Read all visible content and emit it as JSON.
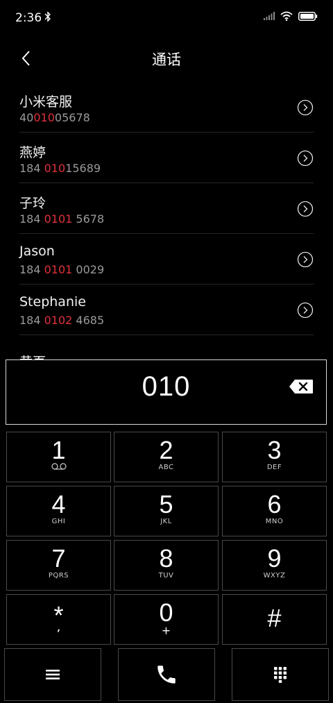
{
  "status_bar": {
    "time": "2:36",
    "icons": [
      "bluetooth-icon",
      "signal-icon",
      "wifi-icon",
      "battery-icon"
    ]
  },
  "header": {
    "title": "通话",
    "back_icon": "chevron-left-icon"
  },
  "contacts": [
    {
      "name": "小米客服",
      "number_pre": "40",
      "number_match": "010",
      "number_post": "05678"
    },
    {
      "name": "燕婷",
      "number_pre": "184 ",
      "number_match": "010",
      "number_post": "15689"
    },
    {
      "name": "子玲",
      "number_pre": "184 ",
      "number_match": "0101",
      "number_post": " 5678"
    },
    {
      "name": "Jason",
      "number_pre": "184 ",
      "number_match": "0101",
      "number_post": " 0029"
    },
    {
      "name": "Stephanie",
      "number_pre": "184 ",
      "number_match": "0102",
      "number_post": " 4685"
    },
    {
      "name": "黄页"
    }
  ],
  "dial": {
    "number": "010",
    "backspace_icon": "backspace-icon"
  },
  "keypad": {
    "keys": [
      {
        "digit": "1",
        "letters": ""
      },
      {
        "digit": "2",
        "letters": "ABC"
      },
      {
        "digit": "3",
        "letters": "DEF"
      },
      {
        "digit": "4",
        "letters": "GHI"
      },
      {
        "digit": "5",
        "letters": "JKL"
      },
      {
        "digit": "6",
        "letters": "MNO"
      },
      {
        "digit": "7",
        "letters": "PQRS"
      },
      {
        "digit": "8",
        "letters": "TUV"
      },
      {
        "digit": "9",
        "letters": "WXYZ"
      },
      {
        "digit": "*",
        "letters": ","
      },
      {
        "digit": "0",
        "letters": "+"
      },
      {
        "digit": "#",
        "letters": ""
      }
    ]
  },
  "actions": {
    "menu_icon": "menu-icon",
    "call_icon": "phone-icon",
    "keypad_icon": "dialpad-icon"
  },
  "colors": {
    "background": "#000000",
    "highlight": "#e0323c",
    "secondary_text": "#9a9a9a"
  }
}
